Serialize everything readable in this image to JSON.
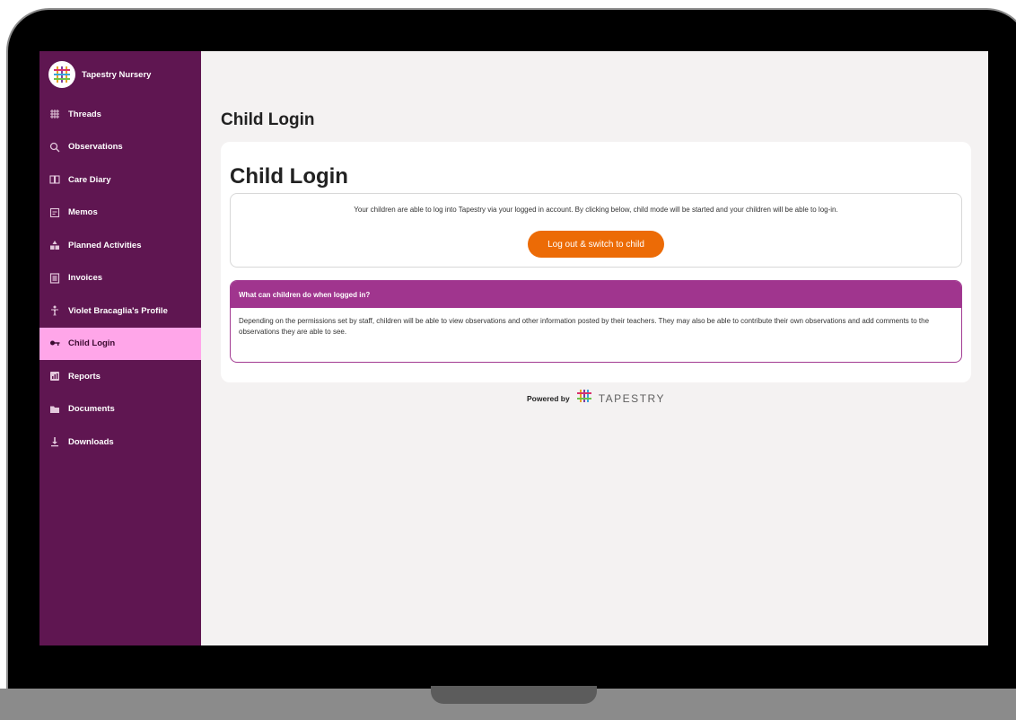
{
  "brand": {
    "name": "Tapestry Nursery"
  },
  "nav": [
    {
      "label": "Threads",
      "icon": "threads-icon"
    },
    {
      "label": "Observations",
      "icon": "search-icon"
    },
    {
      "label": "Care Diary",
      "icon": "book-icon"
    },
    {
      "label": "Memos",
      "icon": "memo-icon"
    },
    {
      "label": "Planned Activities",
      "icon": "blocks-icon"
    },
    {
      "label": "Invoices",
      "icon": "invoice-icon"
    },
    {
      "label": "Violet Bracaglia's Profile",
      "icon": "person-icon"
    },
    {
      "label": "Child Login",
      "icon": "key-icon",
      "active": true
    },
    {
      "label": "Reports",
      "icon": "report-icon"
    },
    {
      "label": "Documents",
      "icon": "folder-icon"
    },
    {
      "label": "Downloads",
      "icon": "download-icon"
    }
  ],
  "page": {
    "title": "Child Login",
    "card_title": "Child Login",
    "info_text": "Your children are able to log into Tapestry via your logged in account. By clicking below, child mode will be started and your children will be able to log-in.",
    "switch_button": "Log out & switch to child",
    "faq_header": "What can children do when logged in?",
    "faq_body": "Depending on the permissions set by staff, children will be able to view observations and other information posted by their teachers. They may also be able to contribute their own observations and add comments to the observations they are able to see."
  },
  "footer": {
    "powered_by": "Powered by",
    "brand": "TAPESTRY"
  },
  "colors": {
    "sidebar": "#5f1651",
    "active_item": "#ffa6e9",
    "accent": "#a0358e",
    "button": "#ec6b06"
  }
}
